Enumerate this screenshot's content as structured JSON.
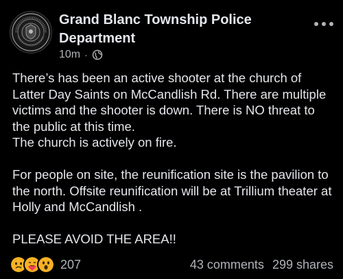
{
  "post": {
    "page_name": "Grand Blanc Township Police Department",
    "timestamp": "10m",
    "separator": "·",
    "audience_icon": "globe-icon",
    "more_icon": "more-options-icon",
    "body": [
      "There’s has been an active shooter at the church of Latter Day Saints on McCandlish Rd. There are multiple victims and the shooter is down. There is NO threat to the public at this time.",
      "The church is actively on fire.",
      "",
      "For people on site, the reunification site is the pavilion to the north. Offsite reunification will be at Trillium theater at Holly and McCandlish .",
      "",
      "PLEASE AVOID THE AREA!!"
    ],
    "reactions": {
      "icons": [
        "sad-face-icon",
        "care-face-icon",
        "wow-face-icon"
      ],
      "count": "207"
    },
    "comments": "43 comments",
    "shares": "299 shares"
  },
  "colors": {
    "background": "#000000",
    "text_primary": "#e4e6eb",
    "text_secondary": "#b0b3b8",
    "reaction_yellow": "#f7b125"
  }
}
